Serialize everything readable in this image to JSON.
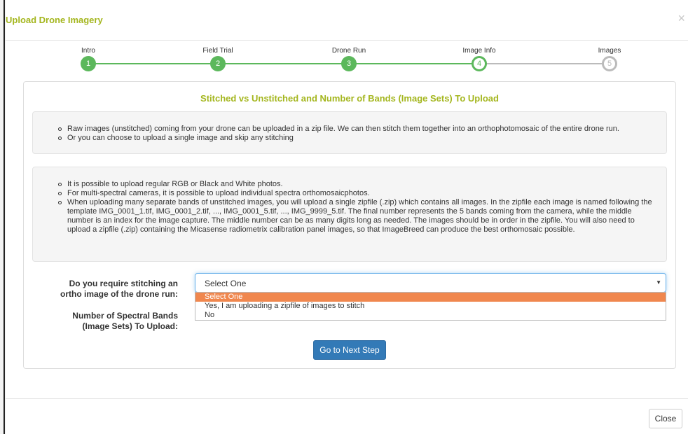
{
  "modal": {
    "title": "Upload Drone Imagery",
    "close_icon": "×"
  },
  "steps": [
    {
      "label": "Intro",
      "number": "1",
      "state": "done"
    },
    {
      "label": "Field Trial",
      "number": "2",
      "state": "done"
    },
    {
      "label": "Drone Run",
      "number": "3",
      "state": "done"
    },
    {
      "label": "Image Info",
      "number": "4",
      "state": "active"
    },
    {
      "label": "Images",
      "number": "5",
      "state": "todo"
    }
  ],
  "panel": {
    "title": "Stitched vs Unstitched and Number of Bands (Image Sets) To Upload",
    "info1": [
      "Raw images (unstitched) coming from your drone can be uploaded in a zip file. We can then stitch them together into an orthophotomosaic of the entire drone run.",
      "Or you can choose to upload a single image and skip any stitching"
    ],
    "info2": [
      "It is possible to upload regular RGB or Black and White photos.",
      "For multi-spectral cameras, it is possible to upload individual spectra orthomosaicphotos.",
      "When uploading many separate bands of unstitched images, you will upload a single zipfile (.zip) which contains all images. In the zipfile each image is named following the template IMG_0001_1.tif, IMG_0001_2.tif, ..., IMG_0001_5.tif, ..., IMG_9999_5.tif. The final number represents the 5 bands coming from the camera, while the middle number is an index for the image capture. The middle number can be as many digits long as needed. The images should be in order in the zipfile. You will also need to upload a zipfile (.zip) containing the Micasense radiometrix calibration panel images, so that ImageBreed can produce the best orthomosaic possible."
    ]
  },
  "form": {
    "stitch_label": "Do you require stitching an ortho image of the drone run:",
    "stitch_selected": "Select One",
    "stitch_options": [
      "Select One",
      "Yes, I am uploading a zipfile of images to stitch",
      "No"
    ],
    "bands_label": "Number of Spectral Bands (Image Sets) To Upload:",
    "next_button": "Go to Next Step"
  },
  "footer": {
    "close_button": "Close"
  },
  "colors": {
    "title": "#a4b61e",
    "step_done": "#5cb85c",
    "step_todo": "#bbbbbb",
    "primary_button": "#337ab7",
    "dropdown_highlight": "#f0874e"
  }
}
